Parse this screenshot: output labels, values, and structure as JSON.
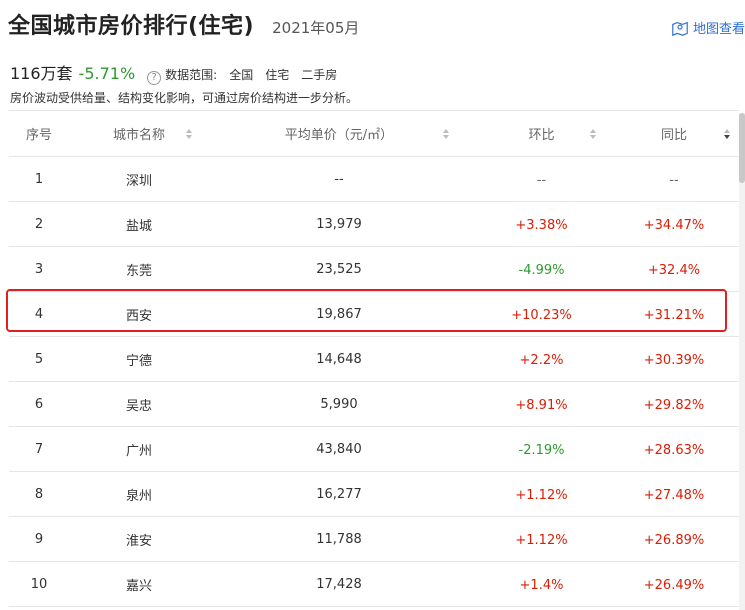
{
  "header": {
    "title": "全国城市房价排行(住宅)",
    "date": "2021年05月",
    "map_link_label": "地图查看"
  },
  "summary": {
    "count": "116万套",
    "change": "-5.71%",
    "help_glyph": "?",
    "scope_label": "数据范围:",
    "scope_items": [
      "全国",
      "住宅",
      "二手房"
    ],
    "note": "房价波动受供给量、结构变化影响，可通过房价结构进一步分析。"
  },
  "table": {
    "headers": [
      "序号",
      "城市名称",
      "平均单价（元/㎡）",
      "环比",
      "同比"
    ],
    "rows": [
      {
        "rank": "1",
        "city": "深圳",
        "price": "--",
        "mom": "--",
        "yoy": "--"
      },
      {
        "rank": "2",
        "city": "盐城",
        "price": "13,979",
        "mom": "+3.38%",
        "yoy": "+34.47%"
      },
      {
        "rank": "3",
        "city": "东莞",
        "price": "23,525",
        "mom": "-4.99%",
        "yoy": "+32.4%"
      },
      {
        "rank": "4",
        "city": "西安",
        "price": "19,867",
        "mom": "+10.23%",
        "yoy": "+31.21%"
      },
      {
        "rank": "5",
        "city": "宁德",
        "price": "14,648",
        "mom": "+2.2%",
        "yoy": "+30.39%"
      },
      {
        "rank": "6",
        "city": "吴忠",
        "price": "5,990",
        "mom": "+8.91%",
        "yoy": "+29.82%"
      },
      {
        "rank": "7",
        "city": "广州",
        "price": "43,840",
        "mom": "-2.19%",
        "yoy": "+28.63%"
      },
      {
        "rank": "8",
        "city": "泉州",
        "price": "16,277",
        "mom": "+1.12%",
        "yoy": "+27.48%"
      },
      {
        "rank": "9",
        "city": "淮安",
        "price": "11,788",
        "mom": "+1.12%",
        "yoy": "+26.89%"
      },
      {
        "rank": "10",
        "city": "嘉兴",
        "price": "17,428",
        "mom": "+1.4%",
        "yoy": "+26.49%"
      }
    ],
    "highlighted_rank": "4",
    "active_sort_column": "同比"
  },
  "colors": {
    "positive": "#d81e06",
    "negative": "#2e9a2e",
    "link": "#2b6fd6",
    "highlight_border": "#e02020"
  },
  "icons": {
    "map": "map-pin-icon",
    "help": "question-circle-icon",
    "sort": "sort-arrows-icon"
  }
}
